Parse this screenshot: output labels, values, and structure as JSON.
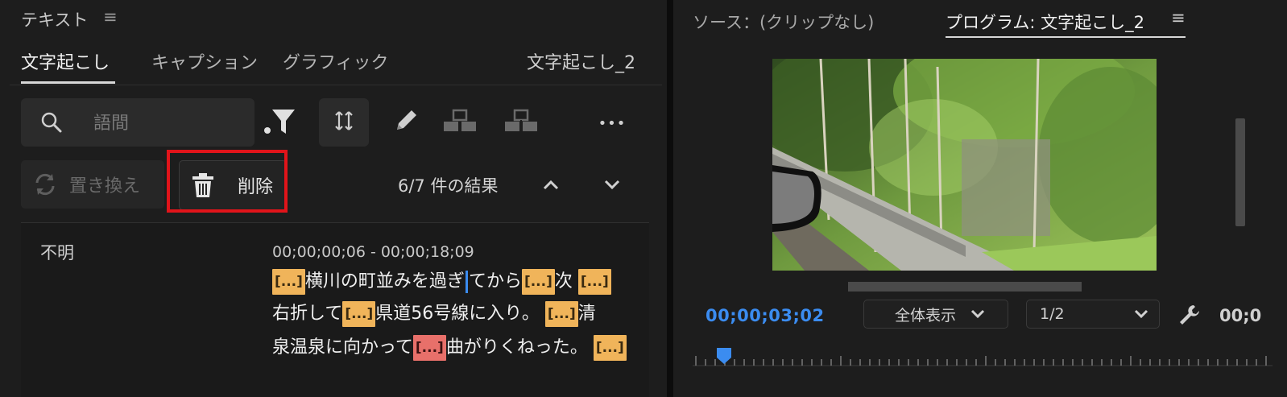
{
  "text_panel": {
    "title": "テキスト",
    "menu_glyph": "≡",
    "tabs": [
      {
        "label": "文字起こし",
        "active": true
      },
      {
        "label": "キャプション",
        "active": false
      },
      {
        "label": "グラフィック",
        "active": false
      }
    ],
    "sequence_title": "文字起こし_2",
    "search": {
      "placeholder": "語間",
      "value": ""
    },
    "toolbar_icons": [
      "search-icon",
      "filter-icon",
      "split-segment-icon",
      "pencil-icon",
      "merge-segments-icon",
      "split-speaker-icon",
      "more-icon"
    ],
    "more_glyph": "•••",
    "replace_label": "置き換え",
    "delete_label": "削除",
    "result_count": "6/7 件の結果",
    "prev_glyph": "⌃",
    "next_glyph": "⌄"
  },
  "transcript": {
    "speaker": "不明",
    "timecode_range": "00;00;00;06 - 00;00;18;09",
    "pause_marker": "[...]",
    "line1": {
      "t1": "横川の町並みを過ぎ",
      "t2": "てから",
      "t3": "次"
    },
    "line2": {
      "t1": "右折して",
      "t2": "県道56号線に入り。",
      "t3": "清"
    },
    "line3": {
      "t1": "泉温泉に向かって",
      "t2": "曲がりくねった。"
    }
  },
  "program_monitor": {
    "source_tab": "ソース：(クリップなし)",
    "program_tab": "プログラム: 文字起こし_2",
    "menu_glyph": "≡",
    "current_timecode": "00;00;03;02",
    "zoom_option": "全体表示",
    "resolution_option": "1/2",
    "end_timecode": "00;0",
    "colors": {
      "accent": "#3b8cf0",
      "pause": "#f0b45a",
      "pause_active": "#e8706a",
      "highlight": "#e1141a"
    }
  }
}
